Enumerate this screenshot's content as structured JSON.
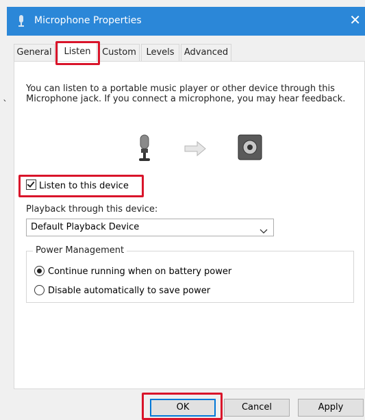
{
  "window": {
    "title": "Microphone Properties",
    "close_glyph": "✕",
    "icon": "microphone-icon"
  },
  "tabs": [
    {
      "label": "General"
    },
    {
      "label": "Listen",
      "active": true
    },
    {
      "label": "Custom"
    },
    {
      "label": "Levels"
    },
    {
      "label": "Advanced"
    }
  ],
  "listen": {
    "description": "You can listen to a portable music player or other device through this Microphone jack. If you connect a microphone, you may hear feedback.",
    "listen_checkbox_label": "Listen to this device",
    "listen_checked": true,
    "playback_label": "Playback through this device:",
    "playback_selected": "Default Playback Device"
  },
  "power": {
    "title": "Power Management",
    "options": [
      {
        "label": "Continue running when on battery power",
        "selected": true
      },
      {
        "label": "Disable automatically to save power",
        "selected": false
      }
    ]
  },
  "buttons": {
    "ok": "OK",
    "cancel": "Cancel",
    "apply": "Apply"
  },
  "colors": {
    "titlebar": "#2b87d8",
    "highlight": "#d9142a"
  }
}
